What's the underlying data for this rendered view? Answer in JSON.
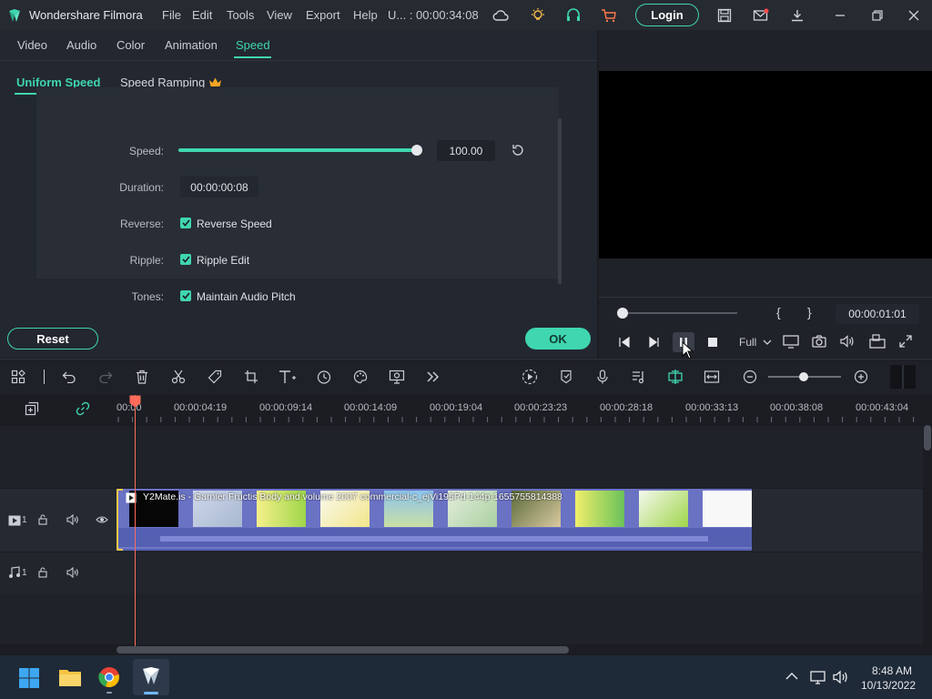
{
  "app": {
    "title": "Wondershare Filmora",
    "project_status": "U... : 00:00:34:08"
  },
  "menu": [
    "File",
    "Edit",
    "Tools",
    "View",
    "Export",
    "Help"
  ],
  "login_label": "Login",
  "tabs": [
    "Video",
    "Audio",
    "Color",
    "Animation",
    "Speed"
  ],
  "active_tab": "Speed",
  "subtabs": [
    "Uniform Speed",
    "Speed Ramping"
  ],
  "speed": {
    "speed_label": "Speed:",
    "speed_value": "100.00",
    "duration_label": "Duration:",
    "duration_value": "00:00:00:08",
    "reverse_label": "Reverse:",
    "reverse_option": "Reverse Speed",
    "ripple_label": "Ripple:",
    "ripple_option": "Ripple Edit",
    "tones_label": "Tones:",
    "tones_option": "Maintain Audio Pitch"
  },
  "reset_label": "Reset",
  "ok_label": "OK",
  "preview": {
    "timecode": "00:00:01:01",
    "quality": "Full",
    "mark_in": "{",
    "mark_out": "}"
  },
  "ruler": [
    "00:00",
    "00:00:04:19",
    "00:00:09:14",
    "00:00:14:09",
    "00:00:19:04",
    "00:00:23:23",
    "00:00:28:18",
    "00:00:33:13",
    "00:00:38:08",
    "00:00:43:04"
  ],
  "clip": {
    "title": "Y2Mate.is - Garnier Fructis Body and volume 2007 commercial-c_ejVi195Pd-144p-1655755814388"
  },
  "tracks": {
    "video_label": "1",
    "audio_label": "1"
  },
  "taskbar": {
    "time": "8:48 AM",
    "date": "10/13/2022"
  },
  "colors": {
    "accent": "#3fd6b0",
    "playhead": "#ff6b5b"
  }
}
